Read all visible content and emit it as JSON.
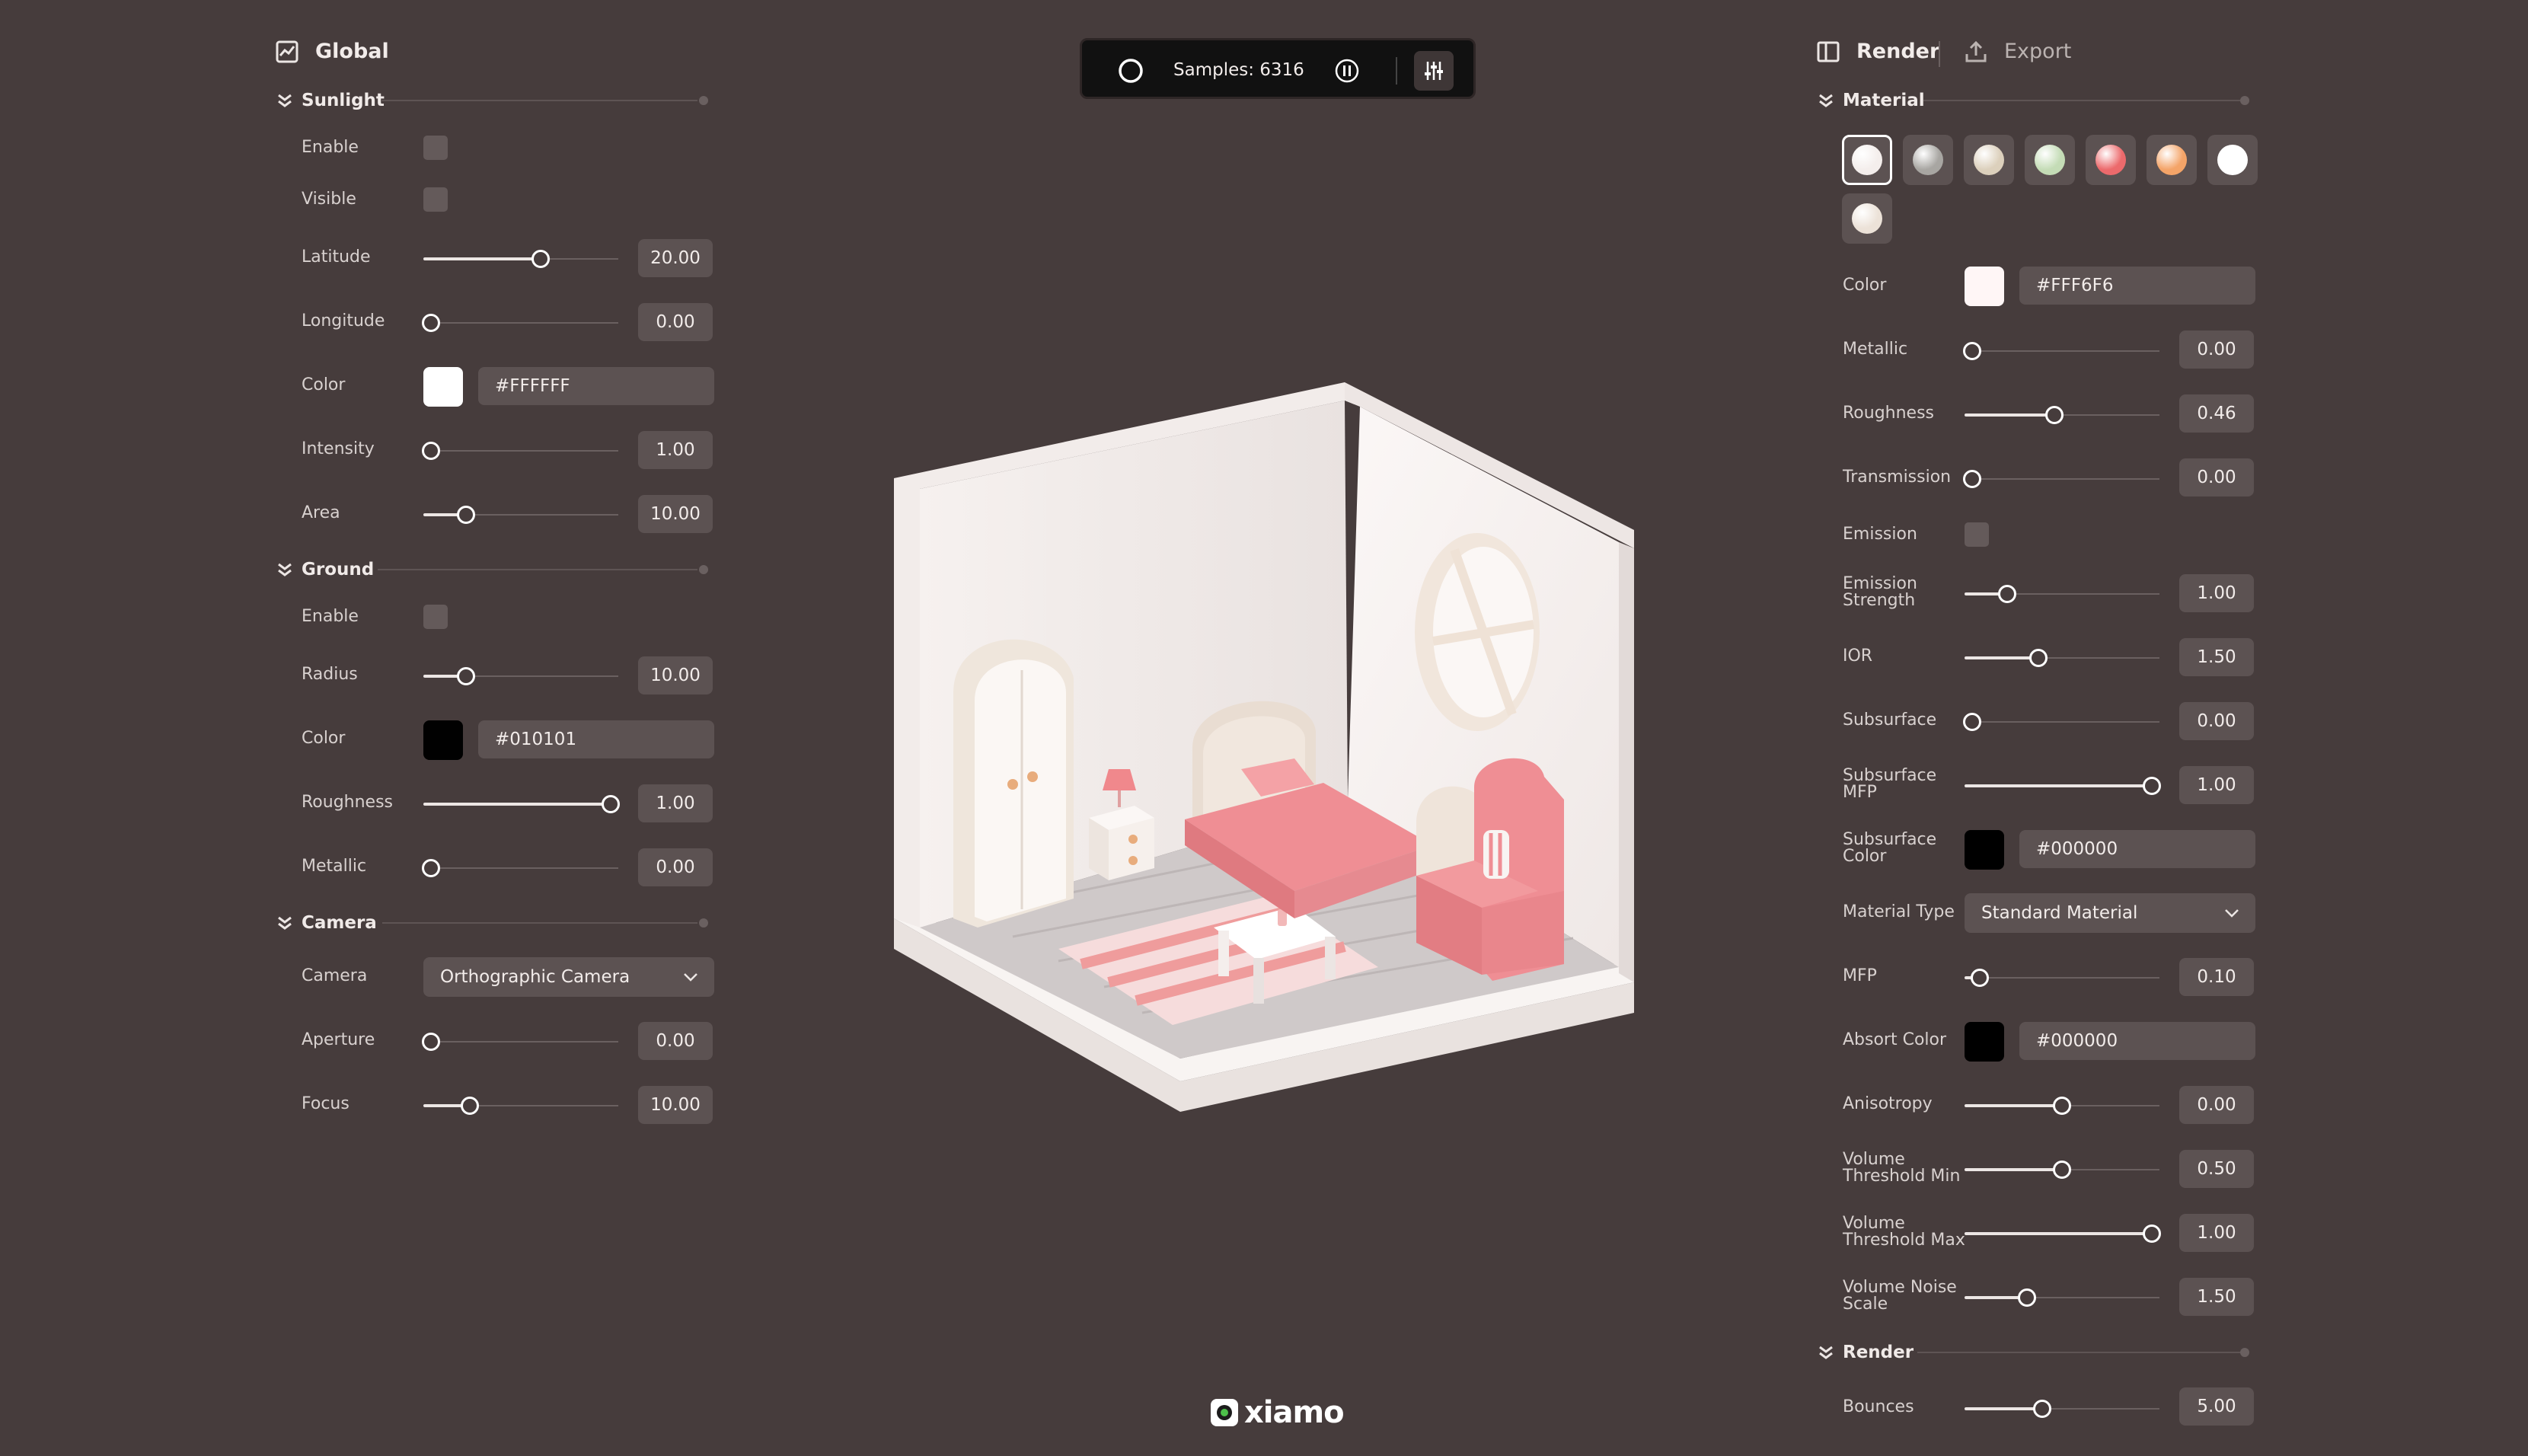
{
  "left_panel": {
    "title": "Global",
    "sections": {
      "sunlight": {
        "title": "Sunlight",
        "enable_label": "Enable",
        "visible_label": "Visible",
        "latitude": {
          "label": "Latitude",
          "value": "20.00",
          "fraction": 0.6
        },
        "longitude": {
          "label": "Longitude",
          "value": "0.00",
          "fraction": 0.04
        },
        "color": {
          "label": "Color",
          "hex": "#FFFFFF",
          "swatch": "#ffffff"
        },
        "intensity": {
          "label": "Intensity",
          "value": "1.00",
          "fraction": 0.04
        },
        "area": {
          "label": "Area",
          "value": "10.00",
          "fraction": 0.22
        }
      },
      "ground": {
        "title": "Ground",
        "enable_label": "Enable",
        "radius": {
          "label": "Radius",
          "value": "10.00",
          "fraction": 0.22
        },
        "color": {
          "label": "Color",
          "hex": "#010101",
          "swatch": "#010101"
        },
        "roughness": {
          "label": "Roughness",
          "value": "1.00",
          "fraction": 0.96
        },
        "metallic": {
          "label": "Metallic",
          "value": "0.00",
          "fraction": 0.04
        }
      },
      "camera": {
        "title": "Camera",
        "camera_label": "Camera",
        "camera_value": "Orthographic Camera",
        "aperture": {
          "label": "Aperture",
          "value": "0.00",
          "fraction": 0.04
        },
        "focus": {
          "label": "Focus",
          "value": "10.00",
          "fraction": 0.24
        }
      }
    }
  },
  "toolbar": {
    "samples": "Samples: 6316",
    "icons": [
      "circle-icon",
      "pause-icon",
      "sliders-icon"
    ]
  },
  "right_panel": {
    "tab_render": "Render",
    "tab_export": "Export",
    "material": {
      "title": "Material",
      "presets": [
        "#f4eeec",
        "#a8a6a2",
        "#dcd0bc",
        "#c4dcb6",
        "#ec6a6c",
        "#f4a468",
        "#ffffff",
        "#ece2d8"
      ],
      "color": {
        "label": "Color",
        "hex": "#FFF6F6",
        "swatch": "#fff6f6"
      },
      "metallic": {
        "label": "Metallic",
        "value": "0.00",
        "fraction": 0.04
      },
      "roughness": {
        "label": "Roughness",
        "value": "0.46",
        "fraction": 0.46
      },
      "transmission": {
        "label": "Transmission",
        "value": "0.00",
        "fraction": 0.04
      },
      "emission_label": "Emission",
      "emission_strength": {
        "label1": "Emission",
        "label2": "Strength",
        "value": "1.00",
        "fraction": 0.22
      },
      "ior": {
        "label": "IOR",
        "value": "1.50",
        "fraction": 0.38
      },
      "subsurface": {
        "label": "Subsurface",
        "value": "0.00",
        "fraction": 0.04
      },
      "subsurface_mfp": {
        "label1": "Subsurface",
        "label2": "MFP",
        "value": "1.00",
        "fraction": 0.96
      },
      "subsurface_color": {
        "label1": "Subsurface",
        "label2": "Color",
        "hex": "#000000",
        "swatch": "#000000"
      },
      "material_type": {
        "label": "Material Type",
        "value": "Standard Material"
      },
      "mfp": {
        "label": "MFP",
        "value": "0.10",
        "fraction": 0.08
      },
      "absorb_color": {
        "label": "Absort Color",
        "hex": "#000000",
        "swatch": "#000000"
      },
      "anisotropy": {
        "label": "Anisotropy",
        "value": "0.00",
        "fraction": 0.5
      },
      "volume_threshold_min": {
        "label1": "Volume",
        "label2": "Threshold Min",
        "value": "0.50",
        "fraction": 0.5
      },
      "volume_threshold_max": {
        "label1": "Volume",
        "label2": "Threshold Max",
        "value": "1.00",
        "fraction": 0.96
      },
      "volume_noise_scale": {
        "label1": "Volume Noise",
        "label2": "Scale",
        "value": "1.50",
        "fraction": 0.32
      }
    },
    "render": {
      "title": "Render",
      "bounces": {
        "label": "Bounces",
        "value": "5.00",
        "fraction": 0.4
      }
    }
  },
  "brand": {
    "name": "xiamo"
  }
}
